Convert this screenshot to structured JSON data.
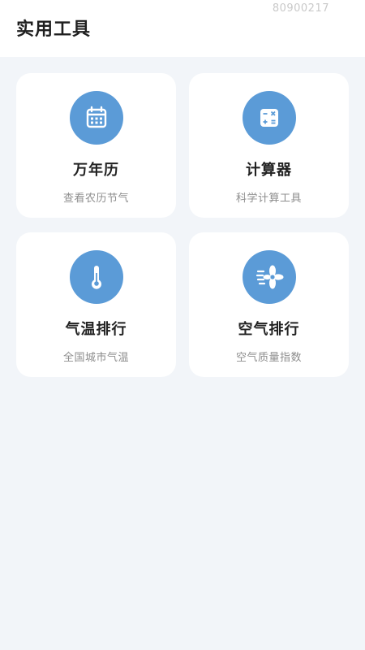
{
  "header": {
    "title": "实用工具",
    "id_text": "80900217"
  },
  "tools": [
    {
      "title": "万年历",
      "subtitle": "查看农历节气",
      "icon": "calendar-icon"
    },
    {
      "title": "计算器",
      "subtitle": "科学计算工具",
      "icon": "calculator-icon"
    },
    {
      "title": "气温排行",
      "subtitle": "全国城市气温",
      "icon": "thermometer-icon"
    },
    {
      "title": "空气排行",
      "subtitle": "空气质量指数",
      "icon": "fan-icon"
    }
  ],
  "colors": {
    "accent": "#5b9bd7",
    "background": "#f2f5f9",
    "card": "#ffffff"
  }
}
